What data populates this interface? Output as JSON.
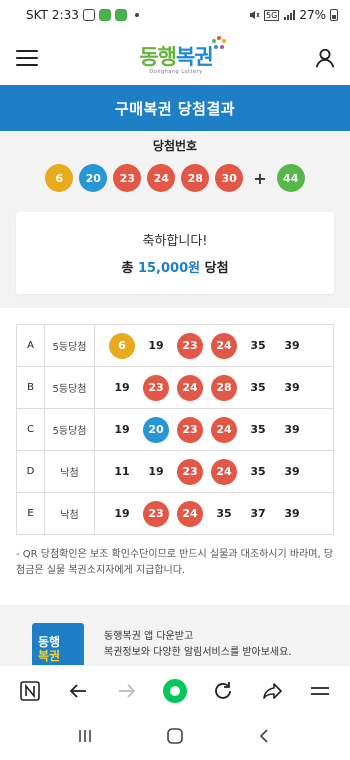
{
  "status_bar": {
    "carrier": "SKT",
    "time": "2:33",
    "battery": "27%",
    "network": "5G"
  },
  "header": {
    "logo_main_1": "동행",
    "logo_main_2": "복권",
    "logo_sub": "Donghang Lottery",
    "menu_icon": "hamburger-icon",
    "account_icon": "user-icon"
  },
  "title": "구매복권 당첨결과",
  "winning": {
    "label": "당첨번호",
    "numbers": [
      {
        "n": "6",
        "color": "#e8ab1e"
      },
      {
        "n": "20",
        "color": "#2596d6"
      },
      {
        "n": "23",
        "color": "#e25745"
      },
      {
        "n": "24",
        "color": "#e25745"
      },
      {
        "n": "28",
        "color": "#e25745"
      },
      {
        "n": "30",
        "color": "#e25745"
      }
    ],
    "plus": "+",
    "bonus": {
      "n": "44",
      "color": "#56b84a"
    }
  },
  "result": {
    "congrats": "축하합니다!",
    "prize_prefix": "총",
    "prize_amount": "15,000원",
    "prize_suffix": "당첨"
  },
  "ticket": {
    "rows": [
      {
        "game": "A",
        "rank": "5등당첨",
        "nums": [
          "6",
          "19",
          "23",
          "24",
          "35",
          "39"
        ],
        "hits": [
          0,
          2,
          3
        ]
      },
      {
        "game": "B",
        "rank": "5등당첨",
        "nums": [
          "19",
          "23",
          "24",
          "28",
          "35",
          "39"
        ],
        "hits": [
          1,
          2,
          3
        ]
      },
      {
        "game": "C",
        "rank": "5등당첨",
        "nums": [
          "19",
          "20",
          "23",
          "24",
          "35",
          "39"
        ],
        "hits": [
          1,
          2,
          3
        ]
      },
      {
        "game": "D",
        "rank": "낙첨",
        "nums": [
          "11",
          "19",
          "23",
          "24",
          "35",
          "39"
        ],
        "hits": [
          2,
          3
        ]
      },
      {
        "game": "E",
        "rank": "낙첨",
        "nums": [
          "19",
          "23",
          "24",
          "35",
          "37",
          "39"
        ],
        "hits": [
          1,
          2
        ]
      }
    ]
  },
  "note": "- QR 당첨확인은 보조 확인수단이므로 반드시 실물과 대조하시기 바라며, 당첨금은 실물 복권소지자에게 지급합니다.",
  "promo": {
    "logo_line1": "동행",
    "logo_line2": "복권",
    "line1": "동행복권 앱 다운받고",
    "line2": "복권정보와 다양한 알림서비스를 받아보세요."
  },
  "colors": {
    "brand_blue": "#1f7fc6",
    "yellow": "#e8ab1e",
    "blue": "#2596d6",
    "red": "#e25745",
    "green": "#56b84a"
  }
}
